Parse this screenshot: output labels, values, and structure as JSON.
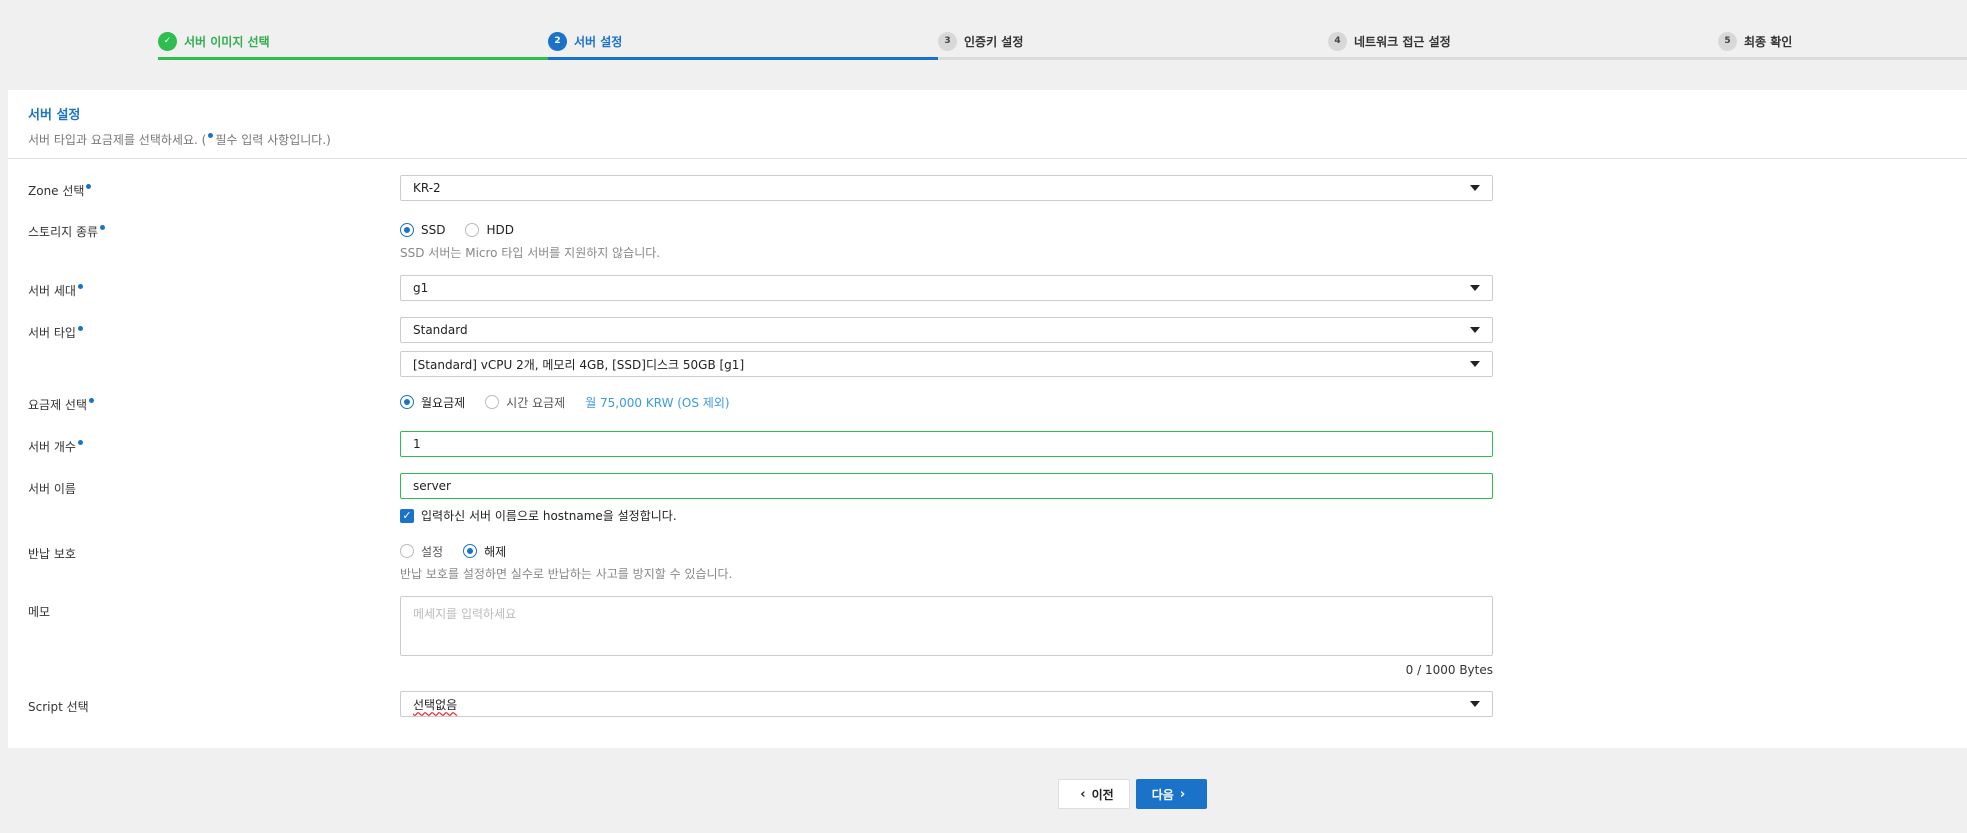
{
  "stepper": {
    "steps": [
      {
        "num": "✓",
        "label": "서버 이미지 선택",
        "state": "done"
      },
      {
        "num": "2",
        "label": "서버 설정",
        "state": "active"
      },
      {
        "num": "3",
        "label": "인증키 설정",
        "state": "todo"
      },
      {
        "num": "4",
        "label": "네트워크 접근 설정",
        "state": "todo"
      },
      {
        "num": "5",
        "label": "최종 확인",
        "state": "todo"
      }
    ]
  },
  "panel": {
    "title": "서버 설정",
    "subtitle_pre": "서버 타입과 요금제를 선택하세요. (",
    "subtitle_post": "필수 입력 사항입니다.)"
  },
  "zone": {
    "label": "Zone 선택",
    "value": "KR-2"
  },
  "storage": {
    "label": "스토리지 종류",
    "options": [
      "SSD",
      "HDD"
    ],
    "selected": "SSD",
    "help": "SSD 서버는 Micro 타입 서버를 지원하지 않습니다."
  },
  "generation": {
    "label": "서버 세대",
    "value": "g1"
  },
  "server_type": {
    "label": "서버 타입",
    "value": "Standard",
    "spec": "[Standard] vCPU 2개, 메모리 4GB, [SSD]디스크 50GB [g1]"
  },
  "billing": {
    "label": "요금제 선택",
    "options": [
      "월요금제",
      "시간 요금제"
    ],
    "selected": "월요금제",
    "price": "월 75,000 KRW (OS 제외)"
  },
  "count": {
    "label": "서버 개수",
    "value": "1"
  },
  "name": {
    "label": "서버 이름",
    "value": "server",
    "hostname_note": "입력하신 서버 이름으로 hostname을 설정합니다."
  },
  "protection": {
    "label": "반납 보호",
    "options": [
      "설정",
      "해제"
    ],
    "selected": "해제",
    "help": "반납 보호를 설정하면 실수로 반납하는 사고를 방지할 수 있습니다."
  },
  "memo": {
    "label": "메모",
    "placeholder": "메세지를 입력하세요",
    "counter": "0 / 1000 Bytes"
  },
  "script": {
    "label": "Script 선택",
    "value": "선택없음"
  },
  "buttons": {
    "prev": "이전",
    "next": "다음"
  },
  "colors": {
    "accent": "#1a73c8",
    "done": "#2ebd4f",
    "price": "#3a9ae0"
  }
}
